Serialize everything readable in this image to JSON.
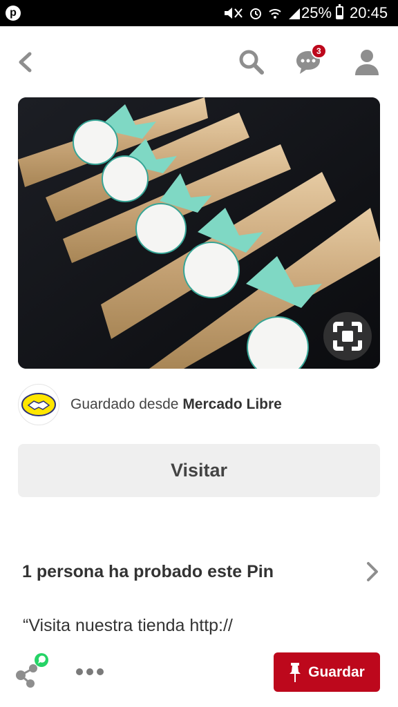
{
  "status_bar": {
    "app_icon": "pinterest-icon",
    "battery_percent": "25%",
    "time": "20:45"
  },
  "header": {
    "icons": [
      "back-arrow-icon",
      "search-icon",
      "chat-bubble-icon",
      "person-icon"
    ],
    "notification_count": "3"
  },
  "pin": {
    "image_subject": "wooden hand fans tied with mint ribbons and round tags",
    "visual_search_icon": "lens-icon"
  },
  "source": {
    "prefix": "Guardado desde",
    "name": "Mercado Libre",
    "logo_icon": "handshake-icon"
  },
  "visit_button": {
    "label": "Visitar"
  },
  "tried": {
    "label": "1 persona ha probado este Pin",
    "chevron": "chevron-right-icon"
  },
  "description": {
    "text": "“Visita nuestra tienda  http://"
  },
  "toolbar": {
    "share_icon": "share-icon",
    "more_icon": "more-dots-icon",
    "save_label": "Guardar",
    "save_icon": "pin-icon"
  },
  "colors": {
    "brand_red": "#bd081c",
    "button_gray": "#efefef",
    "icon_gray": "#8e8e8e",
    "whatsapp_green": "#25d366",
    "mercadolibre_yellow": "#ffe600"
  }
}
